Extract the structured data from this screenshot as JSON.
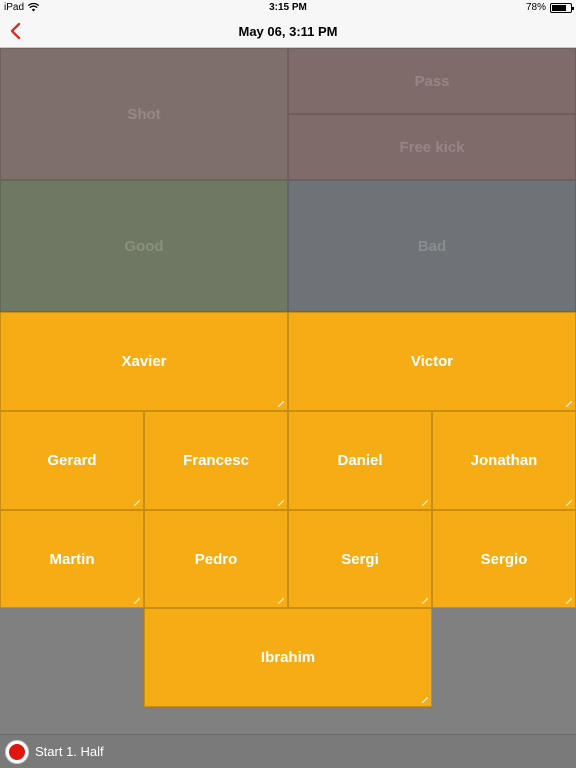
{
  "status_bar": {
    "device": "iPad",
    "time": "3:15 PM",
    "battery_percent": "78%",
    "battery_level": 0.78,
    "wifi_icon": "wifi-icon",
    "battery_icon": "battery-icon"
  },
  "nav": {
    "title": "May 06, 3:11 PM",
    "back_icon": "chevron-left-icon",
    "accent_color": "#d0342c"
  },
  "categories": {
    "shot": "Shot",
    "pass": "Pass",
    "free_kick": "Free kick",
    "good": "Good",
    "bad": "Bad"
  },
  "players": [
    "Xavier",
    "Victor",
    "Gerard",
    "Francesc",
    "Daniel",
    "Jonathan",
    "Martin",
    "Pedro",
    "Sergi",
    "Sergio",
    "Ibrahim"
  ],
  "bottom_bar": {
    "record_icon": "record-icon",
    "label": "Start 1. Half"
  },
  "colors": {
    "player_tile": "#f6ac14",
    "shot_tile": "#7f6f6a",
    "pass_tile": "#7f6b69",
    "good_tile": "#6f7863",
    "bad_tile": "#6f7377",
    "background": "#808080",
    "record": "#e0150e"
  }
}
